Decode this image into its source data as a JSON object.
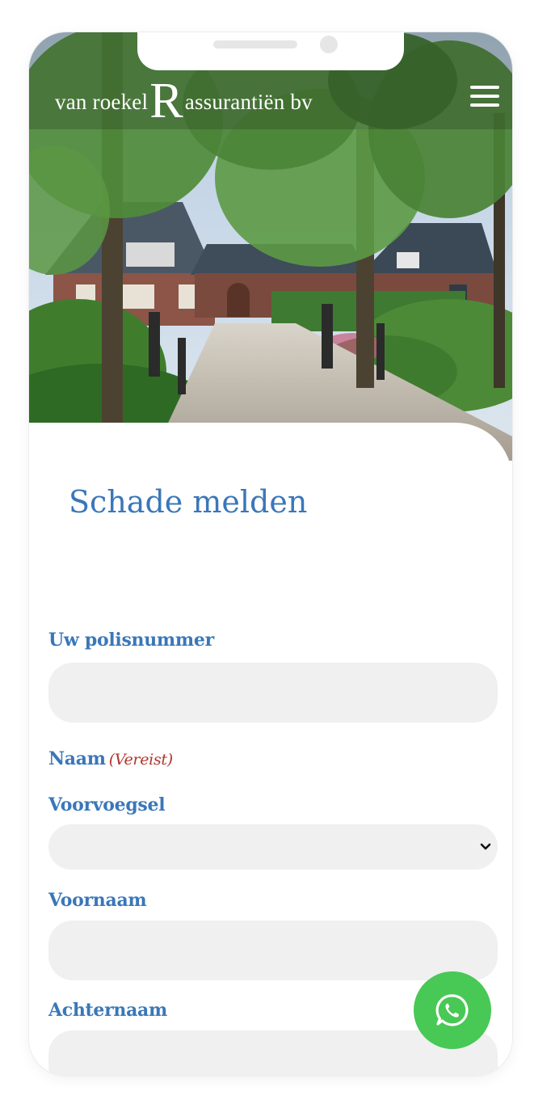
{
  "brand": {
    "name_left": "van roekel",
    "name_mark": "R",
    "name_right": "assurantiën bv"
  },
  "page": {
    "title": "Schade melden"
  },
  "form": {
    "policy": {
      "label": "Uw polisnummer",
      "value": ""
    },
    "name_group": {
      "label": "Naam",
      "required": "(Vereist)"
    },
    "prefix": {
      "label": "Voorvoegsel",
      "value": ""
    },
    "first_name": {
      "label": "Voornaam",
      "value": ""
    },
    "last_name": {
      "label": "Achternaam",
      "value": ""
    }
  },
  "icons": {
    "menu": "hamburger-menu-icon",
    "whatsapp": "whatsapp-icon",
    "select": "chevron-down-icon"
  },
  "colors": {
    "accent": "#3a77b9",
    "required": "#b0362c",
    "field_bg": "#f0f0f0",
    "whatsapp": "#48c855"
  }
}
